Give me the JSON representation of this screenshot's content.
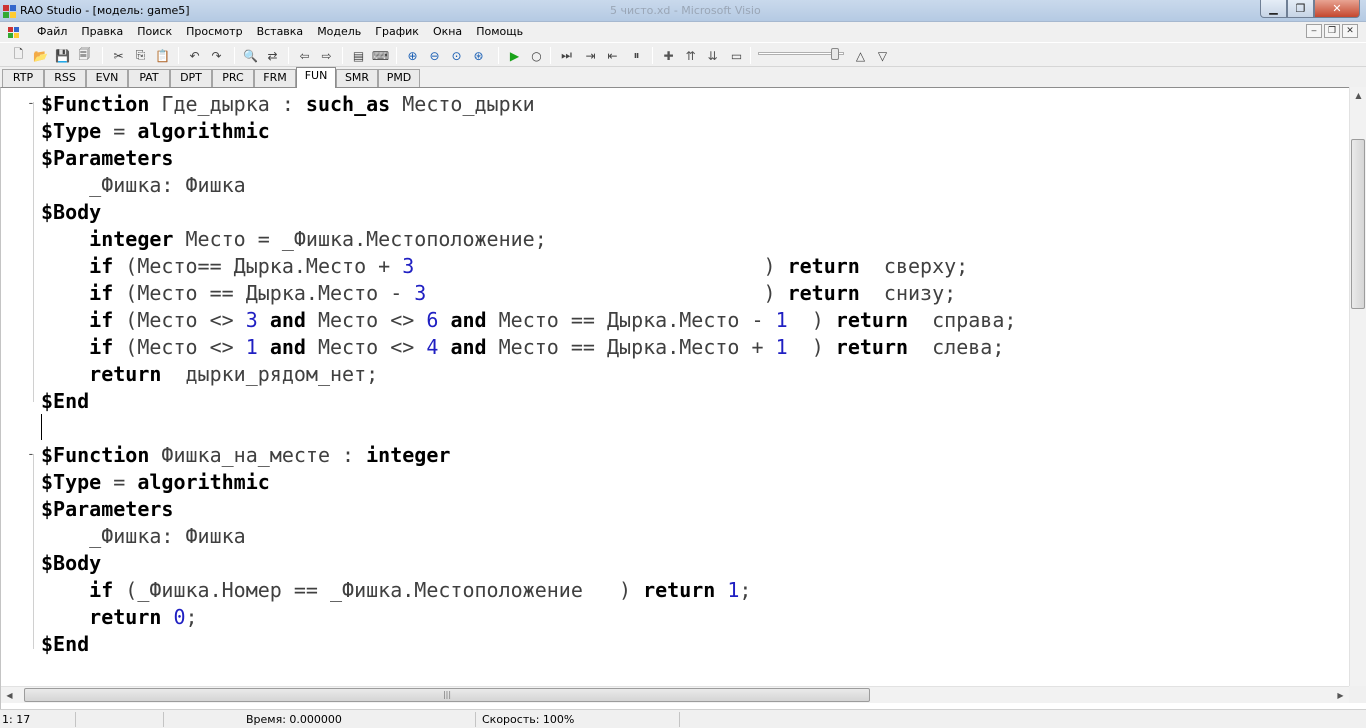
{
  "window": {
    "title": "RAO Studio - [модель: game5]",
    "background_title": "5 чисто.xd - Microsoft Visio"
  },
  "menu": [
    "Файл",
    "Правка",
    "Поиск",
    "Просмотр",
    "Вставка",
    "Модель",
    "График",
    "Окна",
    "Помощь"
  ],
  "toolbar": {
    "icons": [
      "new-icon",
      "open-icon",
      "save-icon",
      "save-all-icon",
      "cut-icon",
      "copy-icon",
      "paste-icon",
      "undo-icon",
      "redo-icon",
      "find-icon",
      "replace-icon",
      "back-icon",
      "forward-icon",
      "bookmark-icon",
      "keyboard-icon",
      "zoom-in-icon",
      "zoom-out-icon",
      "zoom-reset-icon",
      "zoom-fit-icon",
      "run-icon",
      "stop-icon",
      "step-icon",
      "step-over-icon",
      "step-back-icon",
      "pause-icon",
      "add-icon",
      "first-icon",
      "last-icon",
      "remove-icon",
      "up-icon",
      "down-icon"
    ],
    "speed_slider_value": 0.9
  },
  "tabs": [
    "RTP",
    "RSS",
    "EVN",
    "PAT",
    "DPT",
    "PRC",
    "FRM",
    "FUN",
    "SMR",
    "PMD"
  ],
  "active_tab": "FUN",
  "code": [
    [
      [
        "kw",
        "$Function"
      ],
      [
        "t",
        " Где_дырка : "
      ],
      [
        "kw",
        "such_as"
      ],
      [
        "t",
        " Место_дырки"
      ]
    ],
    [
      [
        "kw",
        "$Type"
      ],
      [
        "t",
        " = "
      ],
      [
        "kw",
        "algorithmic"
      ]
    ],
    [
      [
        "kw",
        "$Parameters"
      ]
    ],
    [
      [
        "t",
        "    _Фишка: Фишка"
      ]
    ],
    [
      [
        "kw",
        "$Body"
      ]
    ],
    [
      [
        "t",
        "    "
      ],
      [
        "kw",
        "integer"
      ],
      [
        "t",
        " Место = _Фишка.Местоположение;"
      ]
    ],
    [
      [
        "t",
        "    "
      ],
      [
        "kw",
        "if"
      ],
      [
        "t",
        " (Место== Дырка.Место + "
      ],
      [
        "num",
        "3"
      ],
      [
        "t",
        "                             ) "
      ],
      [
        "kw",
        "return"
      ],
      [
        "t",
        "  сверху;"
      ]
    ],
    [
      [
        "t",
        "    "
      ],
      [
        "kw",
        "if"
      ],
      [
        "t",
        " (Место == Дырка.Место - "
      ],
      [
        "num",
        "3"
      ],
      [
        "t",
        "                            ) "
      ],
      [
        "kw",
        "return"
      ],
      [
        "t",
        "  снизу;"
      ]
    ],
    [
      [
        "t",
        "    "
      ],
      [
        "kw",
        "if"
      ],
      [
        "t",
        " (Место <> "
      ],
      [
        "num",
        "3"
      ],
      [
        "t",
        " "
      ],
      [
        "kw",
        "and"
      ],
      [
        "t",
        " Место <> "
      ],
      [
        "num",
        "6"
      ],
      [
        "t",
        " "
      ],
      [
        "kw",
        "and"
      ],
      [
        "t",
        " Место == Дырка.Место - "
      ],
      [
        "num",
        "1"
      ],
      [
        "t",
        "  ) "
      ],
      [
        "kw",
        "return"
      ],
      [
        "t",
        "  справа;"
      ]
    ],
    [
      [
        "t",
        "    "
      ],
      [
        "kw",
        "if"
      ],
      [
        "t",
        " (Место <> "
      ],
      [
        "num",
        "1"
      ],
      [
        "t",
        " "
      ],
      [
        "kw",
        "and"
      ],
      [
        "t",
        " Место <> "
      ],
      [
        "num",
        "4"
      ],
      [
        "t",
        " "
      ],
      [
        "kw",
        "and"
      ],
      [
        "t",
        " Место == Дырка.Место + "
      ],
      [
        "num",
        "1"
      ],
      [
        "t",
        "  ) "
      ],
      [
        "kw",
        "return"
      ],
      [
        "t",
        "  слева;"
      ]
    ],
    [
      [
        "t",
        "    "
      ],
      [
        "kw",
        "return"
      ],
      [
        "t",
        "  дырки_рядом_нет;"
      ]
    ],
    [
      [
        "kw",
        "$End"
      ]
    ],
    [],
    [
      [
        "kw",
        "$Function"
      ],
      [
        "t",
        " Фишка_на_месте : "
      ],
      [
        "kw",
        "integer"
      ]
    ],
    [
      [
        "kw",
        "$Type"
      ],
      [
        "t",
        " = "
      ],
      [
        "kw",
        "algorithmic"
      ]
    ],
    [
      [
        "kw",
        "$Parameters"
      ]
    ],
    [
      [
        "t",
        "    _Фишка: Фишка"
      ]
    ],
    [
      [
        "kw",
        "$Body"
      ]
    ],
    [
      [
        "t",
        "    "
      ],
      [
        "kw",
        "if"
      ],
      [
        "t",
        " (_Фишка.Номер == _Фишка.Местоположение   ) "
      ],
      [
        "kw",
        "return"
      ],
      [
        "t",
        " "
      ],
      [
        "num",
        "1"
      ],
      [
        "t",
        ";"
      ]
    ],
    [
      [
        "t",
        "    "
      ],
      [
        "kw",
        "return"
      ],
      [
        "t",
        " "
      ],
      [
        "num",
        "0"
      ],
      [
        "t",
        ";"
      ]
    ],
    [
      [
        "kw",
        "$End"
      ]
    ]
  ],
  "status": {
    "position": "1: 17",
    "time": "Время: 0.000000",
    "speed": "Скорость: 100%"
  },
  "colors": {
    "keyword": "#000000",
    "identifier": "#404040",
    "number": "#1f1fc2",
    "editor_bg": "#ffffff"
  }
}
